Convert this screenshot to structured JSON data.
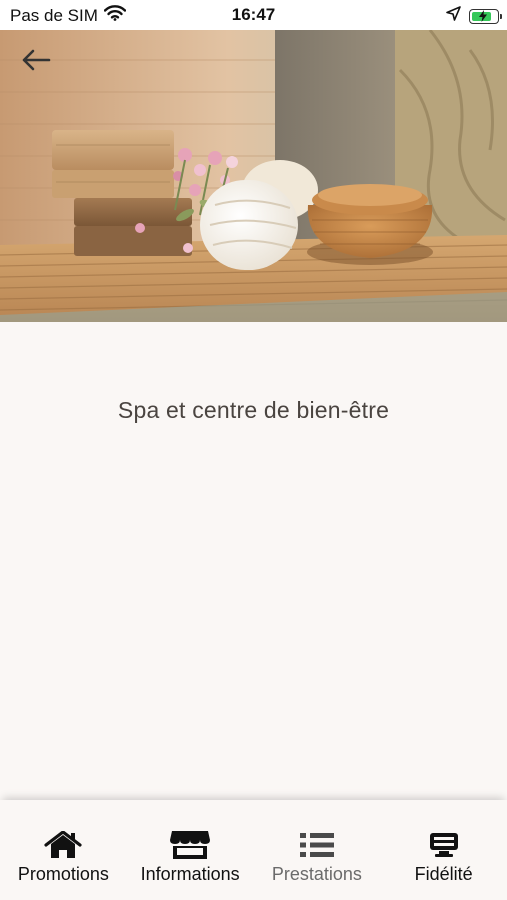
{
  "status_bar": {
    "carrier": "Pas de SIM",
    "time": "16:47",
    "battery_level": 0.85,
    "battery_color": "#35c759"
  },
  "header": {
    "back_icon": "arrow-left-icon"
  },
  "hero": {
    "image_subject": "spa still life: soap bars, rolled white towel, pink flowers, wicker basket on wooden mat"
  },
  "main": {
    "title": "Spa et centre de bien-être"
  },
  "bottom_nav": {
    "items": [
      {
        "label": "Promotions",
        "icon": "home-icon"
      },
      {
        "label": "Informations",
        "icon": "store-icon"
      },
      {
        "label": "Prestations",
        "icon": "list-icon"
      },
      {
        "label": "Fidélité",
        "icon": "loyalty-card-icon"
      }
    ]
  },
  "colors": {
    "background": "#faf7f5",
    "title_text": "#4a4440",
    "nav_active": "#111111",
    "nav_dim": "#6b6b6b"
  }
}
